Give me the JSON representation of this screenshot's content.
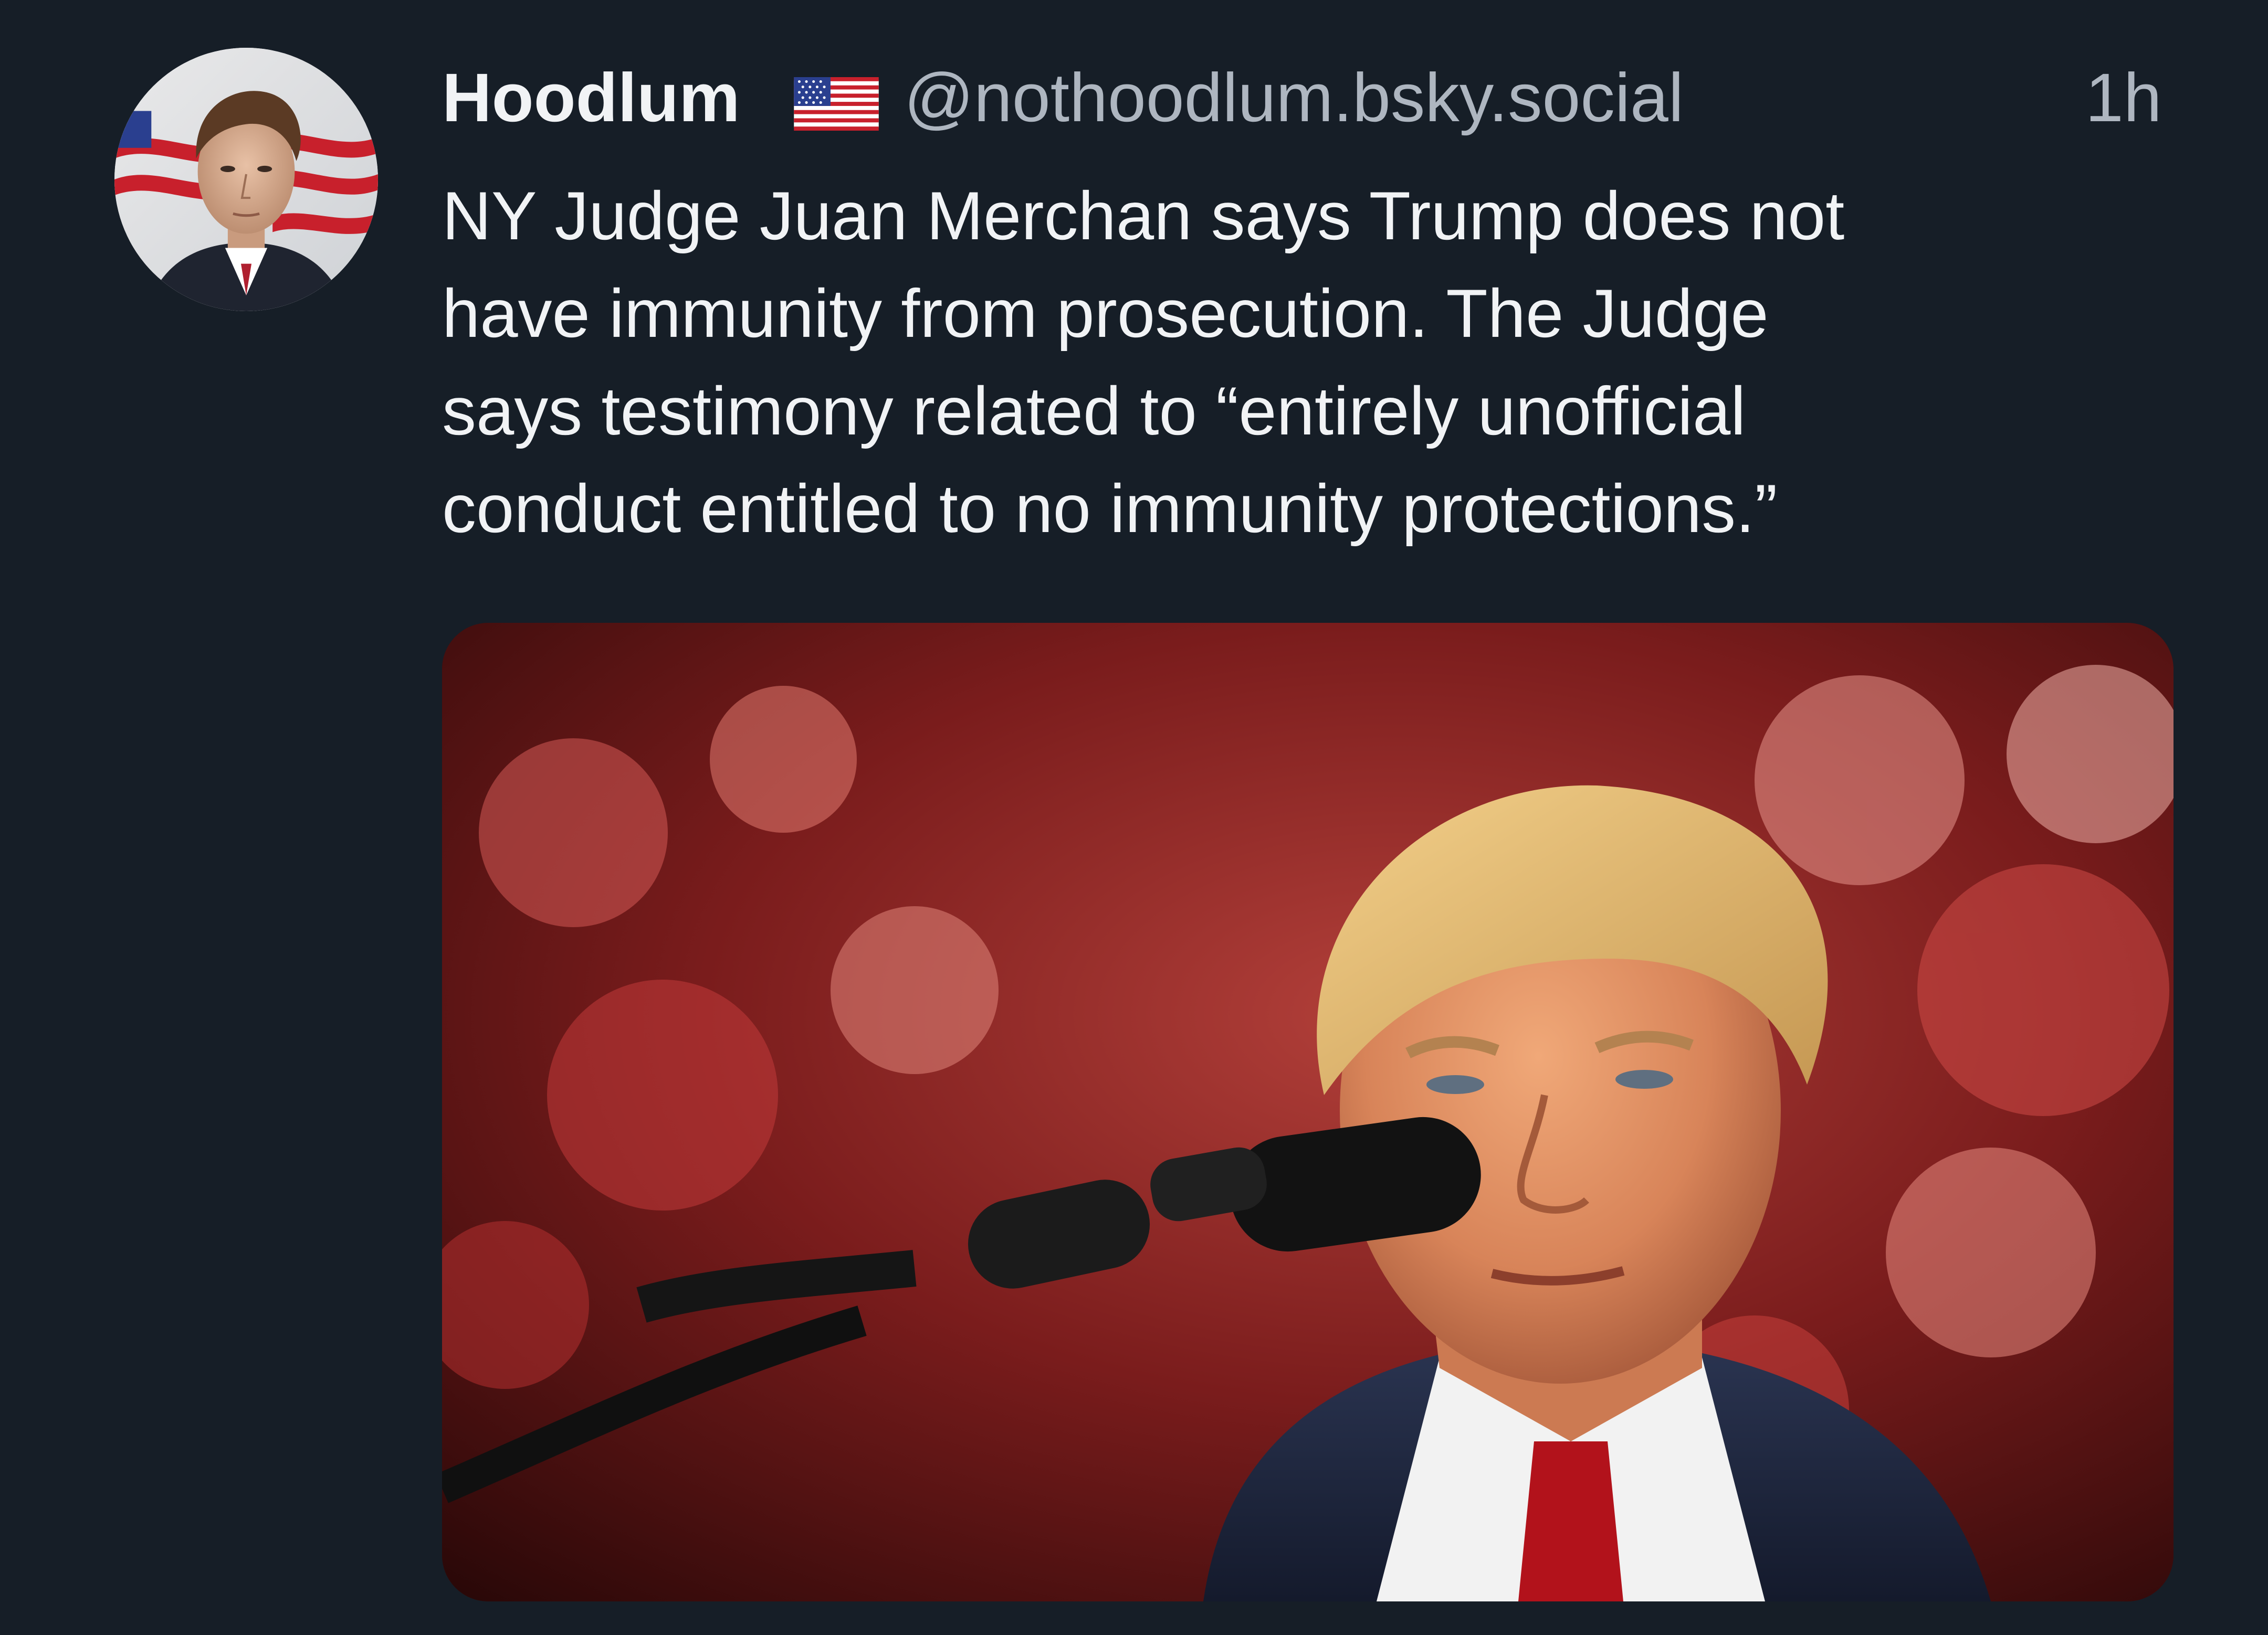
{
  "post": {
    "author": {
      "display_name": "Hoodlum",
      "flag_icon": "us-flag-icon",
      "handle": "@nothoodlum.bsky.social"
    },
    "timestamp": "1h",
    "text_lines": [
      "NY Judge Juan Merchan says Trump does not",
      "have immunity from prosecution. The Judge",
      "says testimony related to “entirely unofficial",
      "conduct entitled to no immunity protections.”"
    ],
    "media": {
      "kind": "photo"
    }
  },
  "colors": {
    "background": "#161e27",
    "primary_text": "#f1f3f5",
    "secondary_text": "#aeb6c0"
  }
}
